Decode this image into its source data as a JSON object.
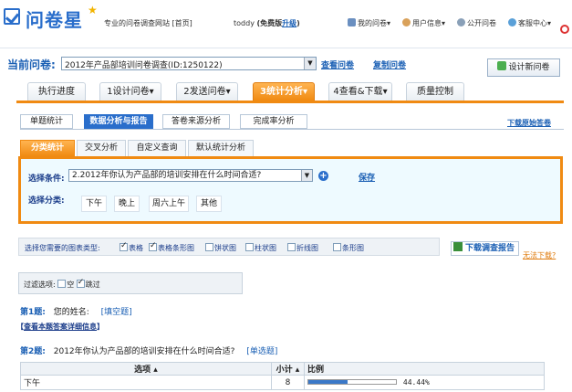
{
  "header": {
    "logo_text": "问卷星",
    "slogan": "专业的问卷调查网站",
    "home_link": "[首页]",
    "username": "toddy",
    "edition": "(免费版",
    "upgrade": "升级",
    "edition_close": ")",
    "nav": [
      "我的问卷",
      "用户信息",
      "公开问卷",
      "客服中心"
    ]
  },
  "current": {
    "label": "当前问卷:",
    "survey": "2012年产品部培训问卷调查(ID:1250122)",
    "view_link": "查看问卷",
    "copy_link": "复制问卷",
    "new_button": "设计新问卷"
  },
  "main_tabs": [
    {
      "label": "执行进度",
      "active": false
    },
    {
      "label": "1设计问卷",
      "active": false
    },
    {
      "label": "2发送问卷",
      "active": false
    },
    {
      "label": "3统计分析",
      "active": true
    },
    {
      "label": "4查看&下载",
      "active": false
    },
    {
      "label": "质量控制",
      "active": false
    }
  ],
  "sub_tabs": [
    {
      "label": "单题统计",
      "active": false
    },
    {
      "label": "数据分析与报告",
      "active": true
    },
    {
      "label": "答卷来源分析",
      "active": false
    },
    {
      "label": "完成率分析",
      "active": false
    }
  ],
  "download_raw": "下载原始答卷",
  "inner_tabs": [
    {
      "label": "分类统计",
      "active": true
    },
    {
      "label": "交叉分析",
      "active": false
    },
    {
      "label": "自定义查询",
      "active": false
    },
    {
      "label": "默认统计分析",
      "active": false
    }
  ],
  "filter": {
    "condition_label": "选择条件:",
    "condition_value": "2.2012年你认为产品部的培训安排在什么时间合适?",
    "save": "保存",
    "category_label": "选择分类:",
    "categories": [
      "下午",
      "晚上",
      "周六上午",
      "其他"
    ]
  },
  "chart_types": {
    "label": "选择您需要的图表类型:",
    "options": [
      {
        "label": "表格",
        "checked": true
      },
      {
        "label": "表格条形图",
        "checked": true
      },
      {
        "label": "饼状图",
        "checked": false
      },
      {
        "label": "柱状图",
        "checked": false
      },
      {
        "label": "折线图",
        "checked": false
      },
      {
        "label": "条形图",
        "checked": false
      }
    ]
  },
  "download_report": "下载调查报告",
  "cant_download": "无法下载?",
  "filter_options": {
    "label": "过滤选项:",
    "options": [
      {
        "label": "空",
        "checked": false
      },
      {
        "label": "跳过",
        "checked": true
      }
    ]
  },
  "q1": {
    "num": "第1题:",
    "title": "您的姓名:",
    "type": "[填空题]"
  },
  "detail_link": {
    "open": "【",
    "text": "查看本题答案详细信息",
    "close": "】"
  },
  "q2": {
    "num": "第2题:",
    "title": "2012年你认为产品部的培训安排在什么时间合适?",
    "type": "[单选题]"
  },
  "table": {
    "headers": [
      "选项",
      "小计",
      "比例"
    ],
    "rows": [
      {
        "option": "下午",
        "count": "8",
        "percent": "44.44%",
        "ratio": 0.4444
      }
    ]
  },
  "colors": {
    "accent": "#f08a12",
    "brand": "#2a6ecb"
  }
}
